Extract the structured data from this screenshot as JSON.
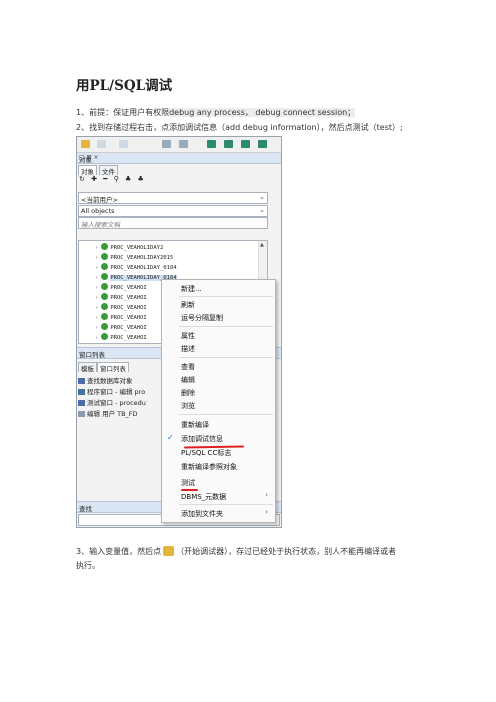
{
  "doc": {
    "title": "用PL/SQL调试",
    "step1_prefix": "1、前提：保证用户有权限",
    "step1_highlight": "debug any process， debug connect session；",
    "step2": "2、找到存储过程右击，点添加调试信息（add debug information），然后点测试（test）;",
    "step3_prefix": "3、输入变量值，然后点",
    "step3_suffix": "（开始调试器），存过已经处于执行状态，别人不能再编译或者",
    "step3_line2": "执行。"
  },
  "screenshot": {
    "pane_title": "对象",
    "pane_controls": "□ ⊠ ×",
    "tabs": [
      "对象",
      "文件"
    ],
    "toolbar_glyphs": "↻ ✚ ━ ⚲ ♣ ♣",
    "user_combo": "<当前用户>",
    "filter_combo": "All objects",
    "search_placeholder": "输入搜索文档",
    "tree_items": [
      "PROC_VEAHOLIDAY2",
      "PROC_VEAHOLIDAY2015",
      "PROC_VEAHOLIDAY_0104",
      "PROC_VEAHOLIDAY_0104",
      "PROC_VEAHOI",
      "PROC_VEAHOI",
      "PROC_VEAHOI",
      "PROC_VEAHOI",
      "PROC_VEAHOI",
      "PROC_VEAHOI"
    ],
    "window_list_title": "窗口列表",
    "window_tabs": [
      "模板",
      "窗口列表"
    ],
    "window_items": [
      "查找数据库对象",
      "程序窗口 - 编辑 pro",
      "测试窗口 - procedu",
      "编辑 用户 TB_FD"
    ],
    "bottom_title": "查找"
  },
  "context_menu": {
    "items": [
      {
        "label": "新建..."
      },
      {
        "label": "刷新"
      },
      {
        "label": "运号分隔复制"
      },
      {
        "label": "属性"
      },
      {
        "label": "描述"
      },
      {
        "label": "查看"
      },
      {
        "label": "编辑"
      },
      {
        "label": "删除"
      },
      {
        "label": "浏览"
      },
      {
        "label": "重新编译"
      },
      {
        "label": "添加调试信息",
        "checked": true
      },
      {
        "label": "PL/SQL CC标志"
      },
      {
        "label": "重新编译参照对象"
      },
      {
        "label": "测试"
      },
      {
        "label": "DBMS_元数据",
        "submenu": "›"
      },
      {
        "label": "添加到文件夹",
        "submenu": "›"
      }
    ]
  },
  "colors": {
    "underline": "#e02020",
    "check": "#1e6fd9",
    "pane_header": "#dbe6f4"
  }
}
